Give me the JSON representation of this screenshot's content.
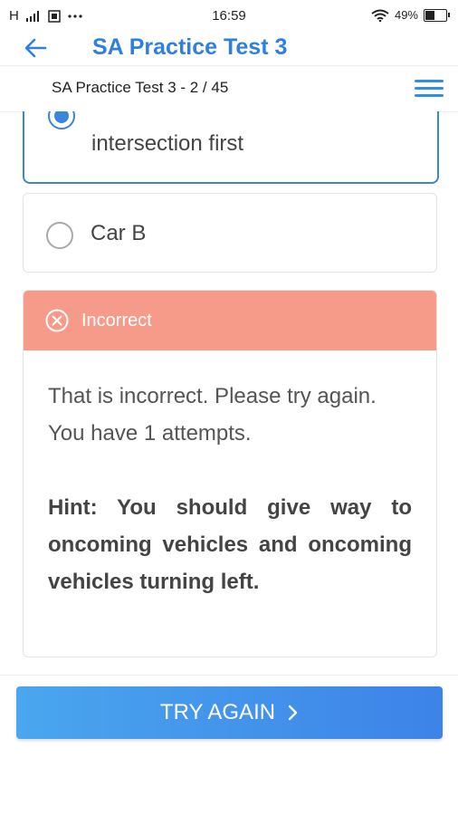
{
  "status_bar": {
    "left_text": "H",
    "time": "16:59",
    "battery_percent": "49%",
    "battery_level": 0.49
  },
  "header": {
    "title": "SA Practice Test 3"
  },
  "sub_header": {
    "title": "SA Practice Test 3 - 2 / 45"
  },
  "options": [
    {
      "label": "intersection first",
      "selected": true
    },
    {
      "label": "Car B",
      "selected": false
    }
  ],
  "feedback": {
    "status": "Incorrect",
    "message": "That is incorrect. Please try again.",
    "attempts": "You have 1 attempts.",
    "hint": "Hint: You should give way to oncoming vehicles and oncoming vehicles turning left."
  },
  "footer": {
    "button_label": "TRY AGAIN"
  },
  "colors": {
    "accent": "#2f7fe0",
    "incorrect": "#f69a8a",
    "button": "#4aa6ee"
  }
}
